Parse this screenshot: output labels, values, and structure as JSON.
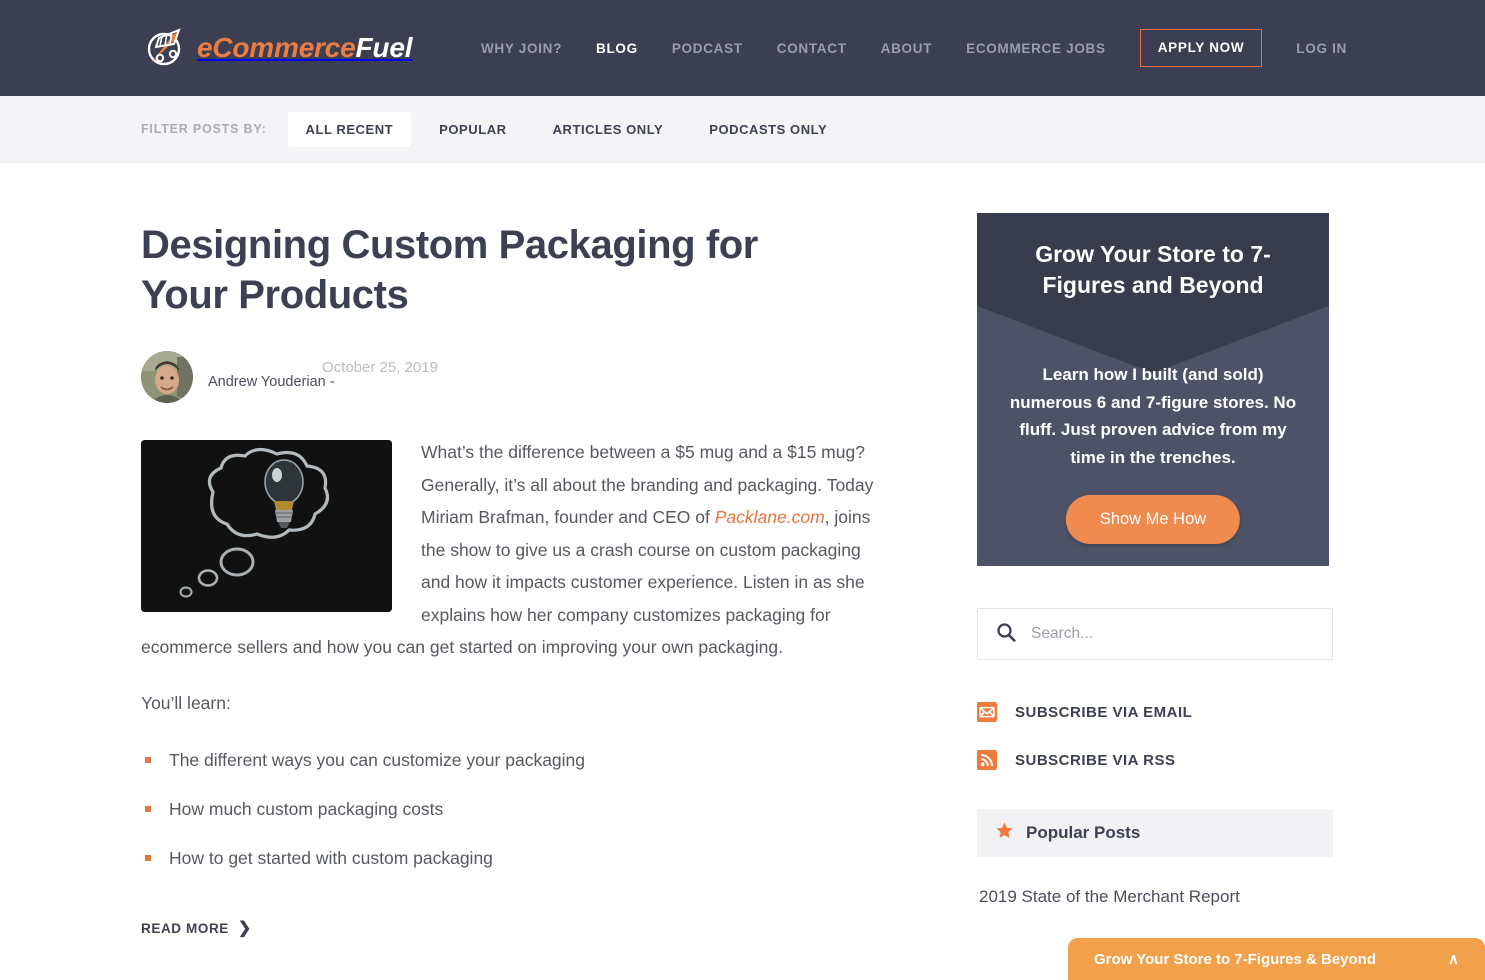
{
  "header": {
    "logo": {
      "icon": "shopping-cart-icon",
      "part_orange": "eCommerce",
      "part_white": "Fuel"
    },
    "nav": [
      {
        "label": "WHY JOIN?",
        "active": false
      },
      {
        "label": "BLOG",
        "active": true
      },
      {
        "label": "PODCAST",
        "active": false
      },
      {
        "label": "CONTACT",
        "active": false
      },
      {
        "label": "ABOUT",
        "active": false
      },
      {
        "label": "ECOMMERCE JOBS",
        "active": false
      }
    ],
    "apply_label": "APPLY NOW",
    "login_label": "LOG IN",
    "bg_color": "#3b3f51",
    "accent_color": "#ec7c41"
  },
  "filter": {
    "label": "FILTER POSTS BY:",
    "options": [
      {
        "label": "ALL RECENT",
        "active": true
      },
      {
        "label": "POPULAR",
        "active": false
      },
      {
        "label": "ARTICLES ONLY",
        "active": false
      },
      {
        "label": "PODCASTS ONLY",
        "active": false
      }
    ]
  },
  "post": {
    "title": "Designing Custom Packaging for Your Products",
    "author": "Andrew Youderian -",
    "date": "October 25, 2019",
    "thumbnail_alt": "lightbulb-chalkboard-thought-bubble",
    "body_part1": "What’s the difference between a $5 mug and a $15 mug? Generally, it’s all about the branding and packaging. Today Miriam Brafman, founder and CEO of ",
    "body_link": "Packlane.com",
    "body_part2": ", joins the show to give us a crash course on custom packaging and how it impacts customer experience. Listen in as she explains how her company customizes packaging for ecommerce sellers and how you can get started on improving your own packaging.",
    "learn_intro": "You’ll learn:",
    "bullets": [
      "The different ways you can customize your packaging",
      "How much custom packaging costs",
      "How to get started with custom packaging"
    ],
    "read_more": "READ MORE",
    "read_more_chevron": "❯"
  },
  "sidebar": {
    "cta": {
      "title": "Grow Your Store to 7-Figures and Beyond",
      "body": "Learn how I built (and sold) numerous 6 and 7-figure stores. No fluff. Just proven advice from my time in the trenches.",
      "button": "Show Me How",
      "button_color": "#ef8b4e",
      "top_color": "#383c4d",
      "body_color": "#4d5266"
    },
    "search": {
      "placeholder": "Search...",
      "value": "",
      "icon": "search-icon"
    },
    "subscribe": [
      {
        "label": "SUBSCRIBE VIA EMAIL",
        "icon": "envelope-icon"
      },
      {
        "label": "SUBSCRIBE VIA RSS",
        "icon": "rss-icon"
      }
    ],
    "popular": {
      "heading": "Popular Posts",
      "icon": "star-icon",
      "items": [
        "2019 State of the Merchant Report"
      ]
    }
  },
  "sticky_bar": {
    "label": "Grow Your Store to 7-Figures & Beyond",
    "chevron": "∧",
    "color": "#f2a04a"
  }
}
